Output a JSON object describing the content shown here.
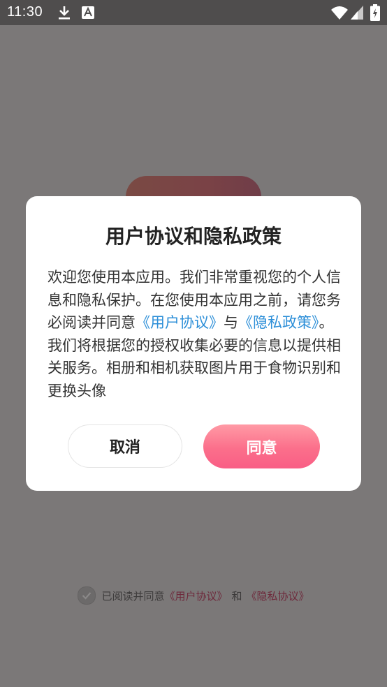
{
  "status_bar": {
    "time": "11:30",
    "icons": [
      "download-icon",
      "a-badge-icon",
      "wifi-icon",
      "signal-icon",
      "battery-icon"
    ]
  },
  "dialog": {
    "title": "用户协议和隐私政策",
    "body_before": "欢迎您使用本应用。我们非常重视您的个人信息和隐私保护。在您使用本应用之前，请您务必阅读并同意",
    "link_user": "《用户协议》",
    "body_and": "与",
    "link_privacy": "《隐私政策》",
    "body_after": "。我们将根据您的授权收集必要的信息以提供相关服务。相册和相机获取图片用于食物识别和更换头像",
    "cancel_label": "取消",
    "agree_label": "同意"
  },
  "footer": {
    "prefix": "已阅读并同意",
    "link_user": "《用户协议》",
    "and": "和",
    "link_privacy": "《隐私协议》",
    "checked": true
  },
  "colors": {
    "link": "#2d8fd8",
    "agree_button": "#fb6f8b",
    "overlay": "#7b7878"
  }
}
